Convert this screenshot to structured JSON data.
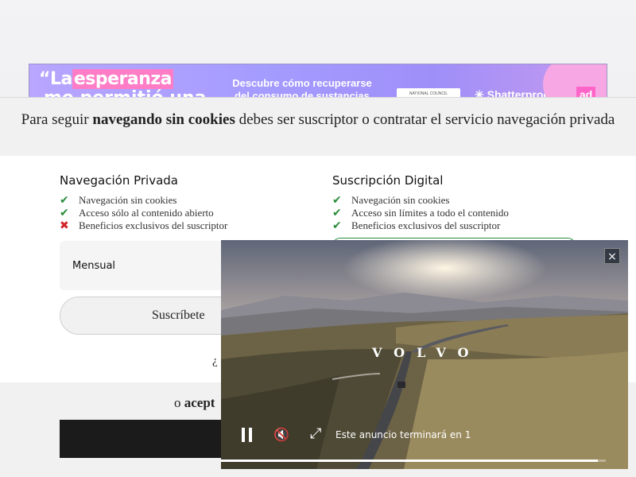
{
  "ad_banner": {
    "headline_prefix": "“La",
    "headline_highlight": "esperanza",
    "headline_line2": "me permitió una",
    "copy": "Descubre cómo recuperarse del consumo de sustancias",
    "logo_box": "NATIONAL COUNCIL",
    "brand": "Shatterproof",
    "badge": "ad"
  },
  "modal": {
    "title_start": "Para seguir ",
    "title_bold": "navegando sin cookies",
    "title_end": " debes ser suscriptor o contratar el servicio navegación privada",
    "left_plan": {
      "title": "Navegación Privada",
      "features": [
        {
          "text": "Navegación sin cookies",
          "mark": "✔"
        },
        {
          "text": "Acceso sólo al contenido abierto",
          "mark": "✔"
        },
        {
          "text": "Beneficios exclusivos del suscriptor",
          "mark": "✖"
        }
      ],
      "option_label": "Mensual",
      "button": "Suscríbete"
    },
    "right_plan": {
      "title": "Suscripción Digital",
      "features": [
        {
          "text": "Navegación sin cookies",
          "mark": "✔"
        },
        {
          "text": "Acceso sin límites a todo el contenido",
          "mark": "✔"
        },
        {
          "text": "Beneficios exclusivos del suscriptor",
          "mark": "✔"
        }
      ]
    },
    "question_fragment": "¿",
    "accept_prefix": "o ",
    "accept_bold": "acept"
  },
  "video_ad": {
    "close": "×",
    "brand": "VOLVO",
    "pause_icon": "pause-icon",
    "mute_glyph": "🔇",
    "fullscreen_glyph": "⤢",
    "ending_text": "Este anuncio terminará en 1",
    "progress": 0.98
  }
}
